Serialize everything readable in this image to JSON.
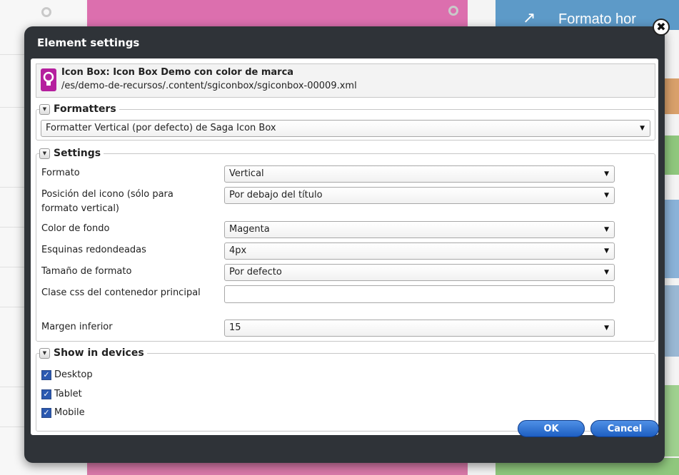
{
  "background": {
    "right_banner": "Formato hor"
  },
  "dialog": {
    "title": "Element settings",
    "close_glyph": "✖"
  },
  "resource": {
    "icon": "lightbulb-icon",
    "title": "Icon Box: Icon Box Demo con color de marca",
    "path": "/es/demo-de-recursos/.content/sgiconbox/sgiconbox-00009.xml"
  },
  "formatters": {
    "legend": "Formatters",
    "selected": "Formatter Vertical (por defecto) de Saga Icon Box"
  },
  "settings": {
    "legend": "Settings",
    "rows": [
      {
        "label": "Formato",
        "value": "Vertical"
      },
      {
        "label": "Posición del icono (sólo para formato vertical)",
        "value": "Por debajo del título"
      },
      {
        "label": "Color de fondo",
        "value": "Magenta"
      },
      {
        "label": "Esquinas redondeadas",
        "value": "4px"
      },
      {
        "label": "Tamaño de formato",
        "value": "Por defecto"
      },
      {
        "label": "Clase css del contenedor principal",
        "value": ""
      },
      {
        "label": "Margen inferior",
        "value": "15"
      }
    ]
  },
  "devices": {
    "legend": "Show in devices",
    "items": [
      {
        "label": "Desktop",
        "checked": true
      },
      {
        "label": "Tablet",
        "checked": true
      },
      {
        "label": "Mobile",
        "checked": true
      }
    ]
  },
  "buttons": {
    "ok": "OK",
    "cancel": "Cancel"
  },
  "colors": {
    "dialog_bg": "#2f3338",
    "button_blue": "#2a6ad0",
    "icon_magenta": "#b51f9e"
  }
}
